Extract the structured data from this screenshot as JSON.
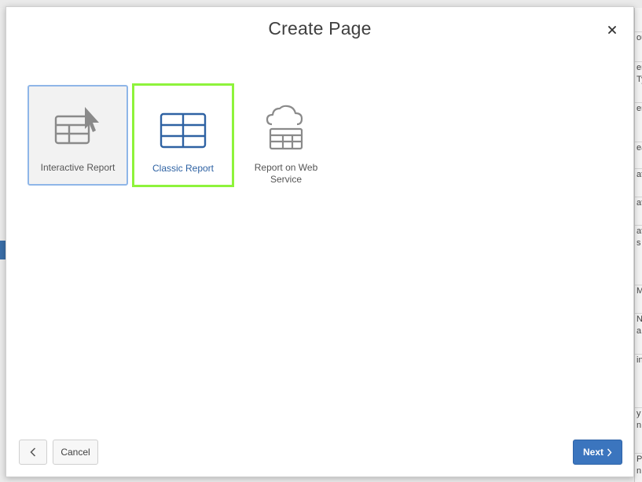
{
  "dialog": {
    "title": "Create Page",
    "close_icon": "close-icon"
  },
  "tiles": [
    {
      "label": "Interactive Report",
      "icon": "interactive-report-icon",
      "state": "hover"
    },
    {
      "label": "Classic Report",
      "icon": "classic-report-icon",
      "state": "selected"
    },
    {
      "label": "Report on Web Service",
      "icon": "web-service-report-icon",
      "state": "default"
    }
  ],
  "footer": {
    "previous_icon": "chevron-left-icon",
    "cancel_label": "Cancel",
    "next_label": "Next",
    "next_icon": "chevron-right-icon"
  },
  "background": {
    "right_panel_fragments": [
      "ou",
      "er",
      "Ty",
      "er",
      "ea",
      "ate",
      "ate",
      "ate",
      "s",
      "Ma",
      "Nu",
      "a",
      "in",
      "y",
      "n",
      "Pa",
      "n"
    ]
  },
  "colors": {
    "selected_outline": "#8ef33b",
    "hover_outline": "#8fb6e8",
    "primary_button": "#3b75be",
    "selected_label": "#2e62a3"
  }
}
